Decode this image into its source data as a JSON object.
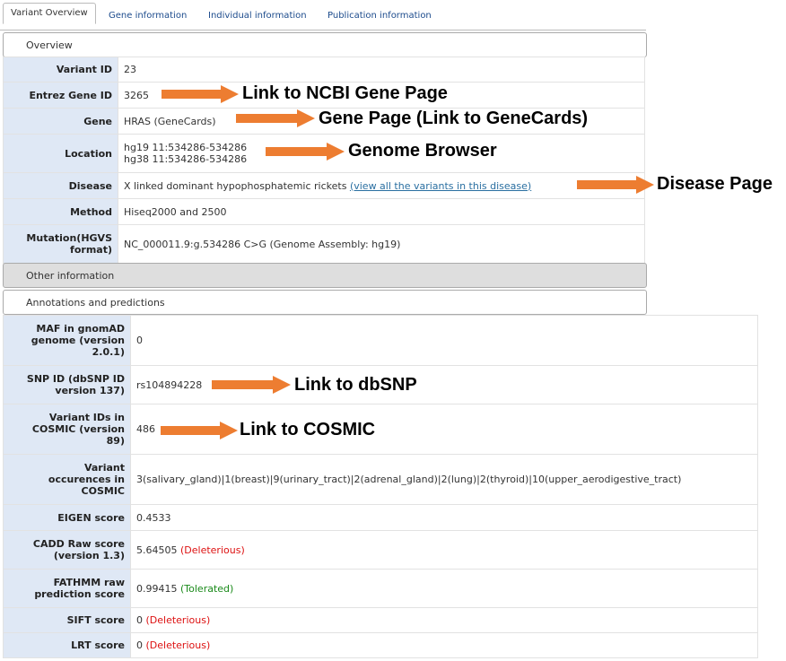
{
  "tabs": [
    "Variant Overview",
    "Gene information",
    "Individual information",
    "Publication information"
  ],
  "sections": {
    "overview": "Overview",
    "other": "Other information",
    "annotations": "Annotations and predictions"
  },
  "overview_rows": {
    "variant_id": {
      "label": "Variant ID",
      "value": "23"
    },
    "entrez": {
      "label": "Entrez Gene ID",
      "value": "3265"
    },
    "gene": {
      "label": "Gene",
      "value": "HRAS (GeneCards)"
    },
    "location": {
      "label": "Location",
      "line1": "hg19 11:534286-534286",
      "line2": "hg38 11:534286-534286"
    },
    "disease": {
      "label": "Disease",
      "value": "X linked dominant hypophosphatemic rickets",
      "link": "(view all the variants in this disease)"
    },
    "method": {
      "label": "Method",
      "value": "Hiseq2000 and 2500"
    },
    "mutation": {
      "label_line1": "Mutation(HGVS",
      "label_line2": "format)",
      "value": "NC_000011.9:g.534286 C>G (Genome Assembly: hg19)"
    }
  },
  "annotation_rows": {
    "maf": {
      "l1": "MAF in gnomAD",
      "l2": "genome (version",
      "l3": "2.0.1)",
      "value": "0"
    },
    "snp": {
      "l1": "SNP ID (dbSNP ID",
      "l2": "version 137)",
      "value": "rs104894228"
    },
    "cosmic": {
      "l1": "Variant IDs in",
      "l2": "COSMIC (version",
      "l3": "89)",
      "value": "486"
    },
    "occ": {
      "l1": "Variant",
      "l2": "occurences in",
      "l3": "COSMIC",
      "value": "3(salivary_gland)|1(breast)|9(urinary_tract)|2(adrenal_gland)|2(lung)|2(thyroid)|10(upper_aerodigestive_tract)"
    },
    "eigen": {
      "label": "EIGEN score",
      "value": "0.4533"
    },
    "cadd": {
      "l1": "CADD Raw score",
      "l2": "(version 1.3)",
      "value": "5.64505",
      "tag": "(Deleterious)"
    },
    "fathmm": {
      "l1": "FATHMM raw",
      "l2": "prediction score",
      "value": "0.99415",
      "tag": "(Tolerated)"
    },
    "sift": {
      "label": "SIFT score",
      "value": "0",
      "tag": "(Deleterious)"
    },
    "lrt": {
      "label": "LRT score",
      "value": "0",
      "tag": "(Deleterious)"
    }
  },
  "annotations": {
    "ncbi": "Link to NCBI Gene Page",
    "genecards": "Gene Page (Link to GeneCards)",
    "browser": "Genome Browser",
    "disease": "Disease Page",
    "dbsnp": "Link to dbSNP",
    "cosmic": "Link to COSMIC"
  },
  "colors": {
    "arrow": "#ed7d31",
    "label_bg": "#dfe8f5",
    "link": "#2a6fa1",
    "deleterious": "#dd1111",
    "tolerated": "#1a8a1a"
  }
}
